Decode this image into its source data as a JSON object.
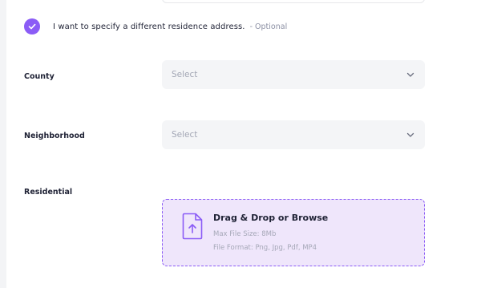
{
  "address_toggle": {
    "checked": true,
    "label": "I want to specify a different residence address.",
    "hint": "- Optional"
  },
  "fields": {
    "county": {
      "label": "County",
      "placeholder": "Select"
    },
    "neighborhood": {
      "label": "Neighborhood",
      "placeholder": "Select"
    },
    "residential": {
      "label": "Residential",
      "title": "Drag & Drop or Browse",
      "max_size": "Max File Size: 8Mb",
      "formats": "File Format: Png, Jpg, Pdf, MP4"
    }
  },
  "icons": {
    "checkbox": "check-icon",
    "dropdown": "chevron-down-icon",
    "upload": "file-upload-icon"
  },
  "colors": {
    "accent": "#8b5cf6",
    "dropzone_bg": "#efe6fb",
    "field_bg": "#f4f5f7",
    "text": "#1f2235",
    "muted": "#a3a7b5"
  }
}
